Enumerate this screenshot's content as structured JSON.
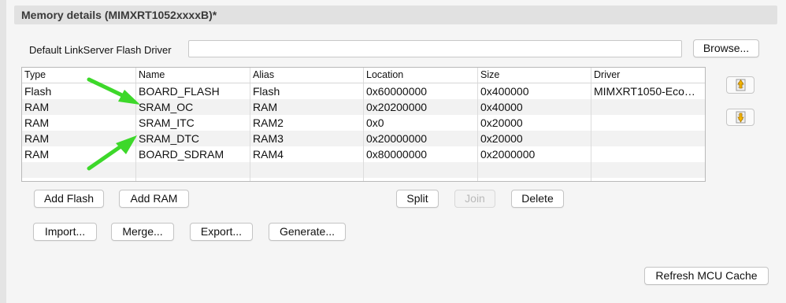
{
  "section": {
    "title": "Memory details (MIMXRT1052xxxxB)*"
  },
  "flash_driver": {
    "label": "Default LinkServer Flash Driver",
    "value": "",
    "browse_label": "Browse..."
  },
  "table": {
    "headers": [
      "Type",
      "Name",
      "Alias",
      "Location",
      "Size",
      "Driver"
    ],
    "rows": [
      [
        "Flash",
        "BOARD_FLASH",
        "Flash",
        "0x60000000",
        "0x400000",
        "MIMXRT1050-Eco…"
      ],
      [
        "RAM",
        "SRAM_OC",
        "RAM",
        "0x20200000",
        "0x40000",
        ""
      ],
      [
        "RAM",
        "SRAM_ITC",
        "RAM2",
        "0x0",
        "0x20000",
        ""
      ],
      [
        "RAM",
        "SRAM_DTC",
        "RAM3",
        "0x20000000",
        "0x20000",
        ""
      ],
      [
        "RAM",
        "BOARD_SDRAM",
        "RAM4",
        "0x80000000",
        "0x2000000",
        ""
      ]
    ]
  },
  "side_buttons": {
    "up_icon": "move-up-icon",
    "down_icon": "move-down-icon"
  },
  "buttons": {
    "add_flash": "Add Flash",
    "add_ram": "Add RAM",
    "split": "Split",
    "join": "Join",
    "delete": "Delete",
    "import": "Import...",
    "merge": "Merge...",
    "export": "Export...",
    "generate": "Generate...",
    "refresh": "Refresh MCU Cache"
  },
  "annotations": {
    "arrow_color": "#3dd82a"
  }
}
